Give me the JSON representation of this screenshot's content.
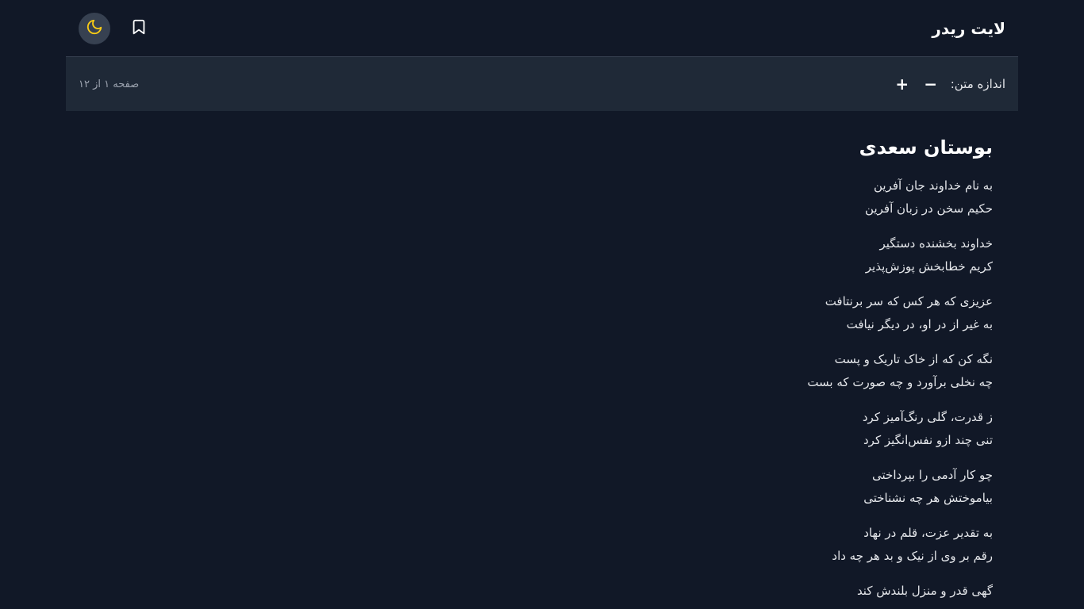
{
  "header": {
    "app_title": "لایت ریدر",
    "theme_toggle_icon": "moon-icon",
    "bookmark_icon": "bookmark-icon"
  },
  "toolbar": {
    "text_size_label": "اندازه متن:",
    "decrease_label": "−",
    "increase_label": "+",
    "page_indicator": "صفحه ۱ از ۱۲"
  },
  "content": {
    "title": "بوستان سعدی",
    "stanzas": [
      {
        "line1": "به نام خداوند جان آفرین",
        "line2": "حکیم سخن در زبان آفرین"
      },
      {
        "line1": "خداوند بخشنده دستگیر",
        "line2": "کریم خطابخش پوزش‌پذیر"
      },
      {
        "line1": "عزیزی که هر کس که سر برنتافت",
        "line2": "به غیر از در او، در دیگر نیافت"
      },
      {
        "line1": "نگه کن که از خاک تاریک و پست",
        "line2": "چه نخلی برآورد و چه صورت که بست"
      },
      {
        "line1": "ز قدرت، گلی رنگ‌آمیز کرد",
        "line2": "تنی چند ازو نفس‌انگیز کرد"
      },
      {
        "line1": "چو کار آدمی را بپرداختی",
        "line2": "بیاموختش هر چه نشناختی"
      },
      {
        "line1": "به تقدیر عزت، قلم در نهاد",
        "line2": "رقم بر وی از نیک و بد هر چه داد"
      },
      {
        "line1": "گهی قدر و منزل بلندش کند",
        "line2": ""
      }
    ]
  },
  "colors": {
    "background": "#111827",
    "toolbar_bg": "#1f2937",
    "moon_accent": "#facc15"
  }
}
